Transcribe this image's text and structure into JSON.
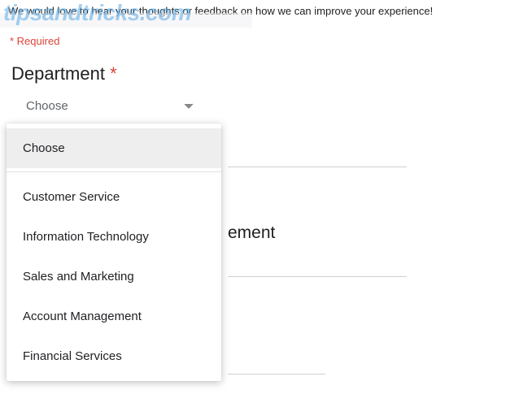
{
  "watermark": "tipsandtricks.com",
  "description": "We would love to hear your thoughts or feedback on how we can improve your experience!",
  "required_note": "* Required",
  "question": {
    "label": "Department",
    "asterisk": "*",
    "selected": "Choose"
  },
  "dropdown": {
    "placeholder": "Choose",
    "options": [
      "Customer Service",
      "Information Technology",
      "Sales and Marketing",
      "Account Management",
      "Financial Services"
    ]
  },
  "background_partial": "ement"
}
